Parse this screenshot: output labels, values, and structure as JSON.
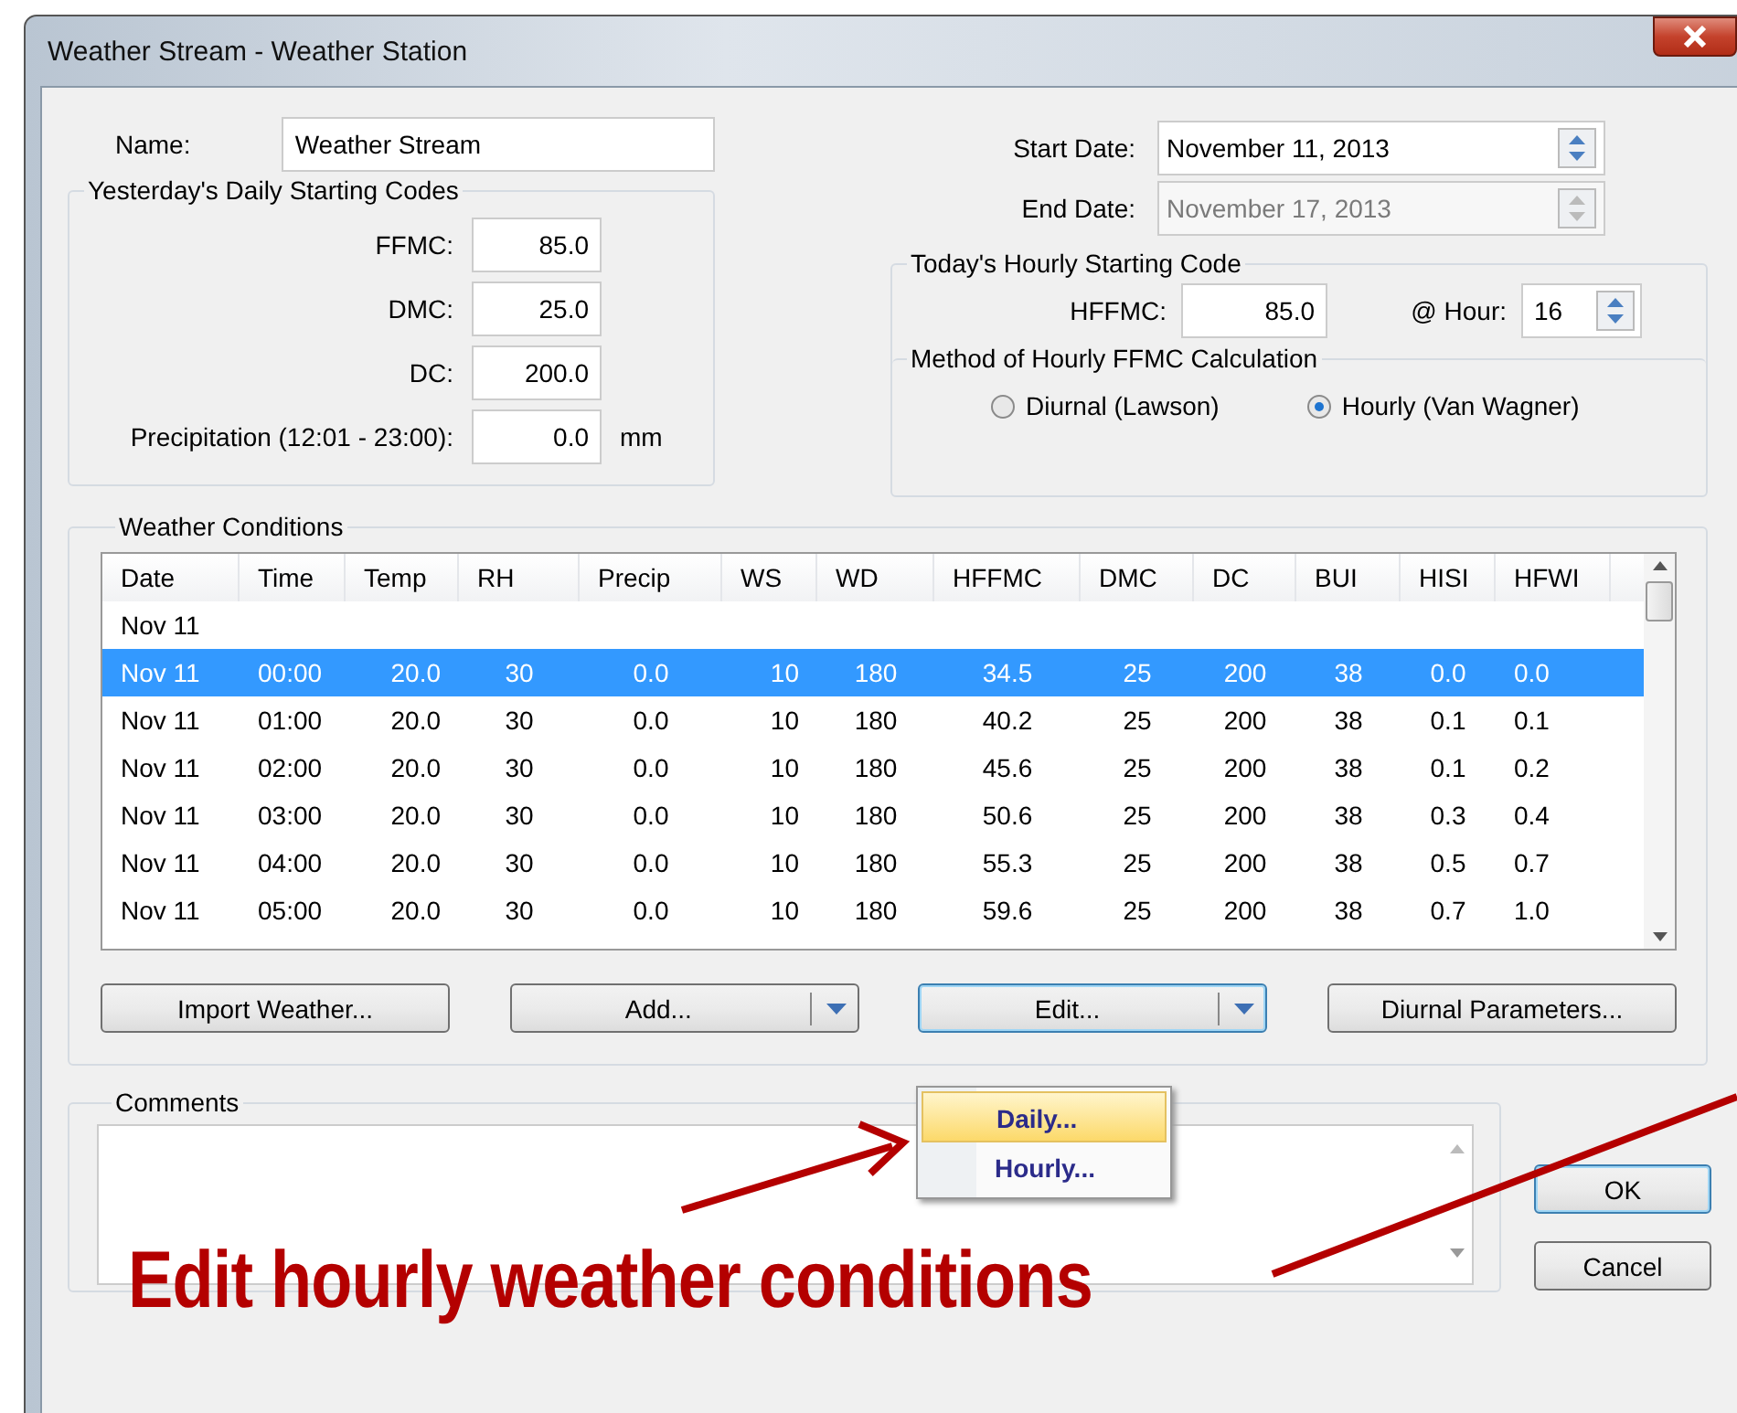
{
  "window": {
    "title": "Weather Stream - Weather Station"
  },
  "name": {
    "label": "Name:",
    "value": "Weather Stream"
  },
  "dates": [
    {
      "label": "Start Date:",
      "value": "November 11, 2013",
      "disabled": false
    },
    {
      "label": "End Date:",
      "value": "November 17, 2013",
      "disabled": true
    }
  ],
  "yesterday": {
    "title": "Yesterday's Daily Starting Codes",
    "fields": [
      {
        "label": "FFMC:",
        "value": "85.0"
      },
      {
        "label": "DMC:",
        "value": "25.0"
      },
      {
        "label": "DC:",
        "value": "200.0"
      },
      {
        "label": "Precipitation (12:01 - 23:00):",
        "value": "0.0",
        "unit": "mm"
      }
    ]
  },
  "today": {
    "title": "Today's Hourly Starting Code",
    "hffmc_label": "HFFMC:",
    "hffmc_value": "85.0",
    "hour_label": "@ Hour:",
    "hour_value": "16"
  },
  "method": {
    "title": "Method of Hourly FFMC Calculation",
    "options": [
      {
        "label": "Diurnal (Lawson)",
        "selected": false
      },
      {
        "label": "Hourly (Van Wagner)",
        "selected": true
      }
    ]
  },
  "weather": {
    "title": "Weather Conditions",
    "columns": [
      "Date",
      "Time",
      "Temp",
      "RH",
      "Precip",
      "WS",
      "WD",
      "HFFMC",
      "DMC",
      "DC",
      "BUI",
      "HISI",
      "HFWI"
    ],
    "rows": [
      {
        "cells": [
          "Nov 11"
        ],
        "selected": false
      },
      {
        "cells": [
          "Nov 11",
          "00:00",
          "20.0",
          "30",
          "0.0",
          "10",
          "180",
          "34.5",
          "25",
          "200",
          "38",
          "0.0",
          "0.0"
        ],
        "selected": true
      },
      {
        "cells": [
          "Nov 11",
          "01:00",
          "20.0",
          "30",
          "0.0",
          "10",
          "180",
          "40.2",
          "25",
          "200",
          "38",
          "0.1",
          "0.1"
        ],
        "selected": false
      },
      {
        "cells": [
          "Nov 11",
          "02:00",
          "20.0",
          "30",
          "0.0",
          "10",
          "180",
          "45.6",
          "25",
          "200",
          "38",
          "0.1",
          "0.2"
        ],
        "selected": false
      },
      {
        "cells": [
          "Nov 11",
          "03:00",
          "20.0",
          "30",
          "0.0",
          "10",
          "180",
          "50.6",
          "25",
          "200",
          "38",
          "0.3",
          "0.4"
        ],
        "selected": false
      },
      {
        "cells": [
          "Nov 11",
          "04:00",
          "20.0",
          "30",
          "0.0",
          "10",
          "180",
          "55.3",
          "25",
          "200",
          "38",
          "0.5",
          "0.7"
        ],
        "selected": false
      },
      {
        "cells": [
          "Nov 11",
          "05:00",
          "20.0",
          "30",
          "0.0",
          "10",
          "180",
          "59.6",
          "25",
          "200",
          "38",
          "0.7",
          "1.0"
        ],
        "selected": false
      }
    ],
    "buttons": [
      {
        "label": "Import Weather...",
        "dropdown": false,
        "focused": false
      },
      {
        "label": "Add...",
        "dropdown": true,
        "focused": false
      },
      {
        "label": "Edit...",
        "dropdown": true,
        "focused": true
      },
      {
        "label": "Diurnal Parameters...",
        "dropdown": false,
        "focused": false
      }
    ]
  },
  "menu": {
    "items": [
      {
        "label": "Daily...",
        "selected": true
      },
      {
        "label": "Hourly...",
        "selected": false
      }
    ]
  },
  "comments": {
    "title": "Comments"
  },
  "dialog_buttons": [
    {
      "label": "OK",
      "default": true
    },
    {
      "label": "Cancel",
      "default": false
    }
  ],
  "annotation": {
    "text": "Edit hourly weather conditions"
  }
}
